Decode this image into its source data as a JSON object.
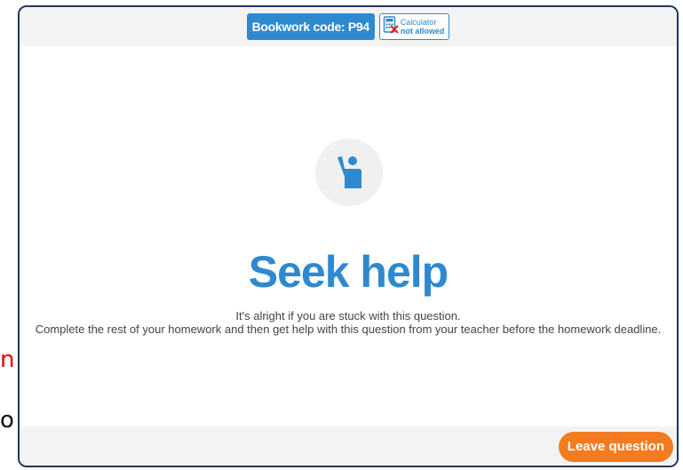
{
  "background": {
    "fragment_1": "n",
    "fragment_2": "o"
  },
  "header": {
    "bookwork_label": "Bookwork code: P94",
    "calculator": {
      "line1": "Calculator",
      "line2": "not allowed",
      "icon": "calculator-not-allowed-icon"
    }
  },
  "main": {
    "icon": "hand-raised-icon",
    "title": "Seek help",
    "message_line1": "It's alright if you are stuck with this question.",
    "message_line2": "Complete the rest of your homework and then get help with this question from your teacher before the homework deadline."
  },
  "footer": {
    "leave_label": "Leave question"
  },
  "colors": {
    "primary_blue": "#2f89cf",
    "accent_orange": "#f47b20",
    "header_bg": "#f3f3f3",
    "border": "#1f3658"
  }
}
